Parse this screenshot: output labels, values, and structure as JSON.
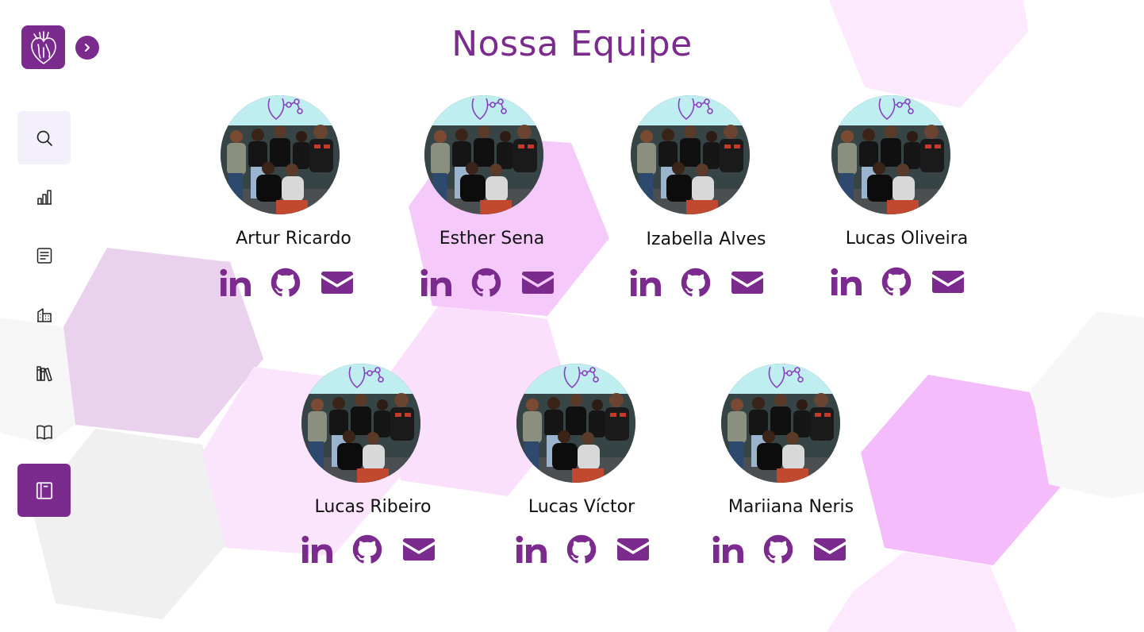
{
  "colors": {
    "accent": "#7b2a8e",
    "hex_pink": "#f2c0fa",
    "hex_grey": "#ececec"
  },
  "sidebar": {
    "logo_icon": "heart-anatomy-icon",
    "expand_icon": "chevron-right-icon",
    "items": [
      {
        "icon": "search-icon",
        "state": "hover"
      },
      {
        "icon": "bar-chart-icon",
        "state": "normal"
      },
      {
        "icon": "document-icon",
        "state": "normal"
      },
      {
        "icon": "buildings-icon",
        "state": "normal"
      },
      {
        "icon": "library-icon",
        "state": "normal"
      },
      {
        "icon": "open-book-icon",
        "state": "normal"
      },
      {
        "icon": "notebook-icon",
        "state": "active"
      }
    ]
  },
  "page": {
    "title": "Nossa Equipe"
  },
  "team": [
    {
      "name": "Artur Ricardo",
      "links": [
        "linkedin-icon",
        "github-icon",
        "email-icon"
      ]
    },
    {
      "name": "Esther Sena",
      "links": [
        "linkedin-icon",
        "github-icon",
        "email-icon"
      ]
    },
    {
      "name": "Izabella Alves",
      "links": [
        "linkedin-icon",
        "github-icon",
        "email-icon"
      ]
    },
    {
      "name": "Lucas Oliveira",
      "links": [
        "linkedin-icon",
        "github-icon",
        "email-icon"
      ]
    },
    {
      "name": "Lucas Ribeiro",
      "links": [
        "linkedin-icon",
        "github-icon",
        "email-icon"
      ]
    },
    {
      "name": "Lucas Víctor",
      "links": [
        "linkedin-icon",
        "github-icon",
        "email-icon"
      ]
    },
    {
      "name": "Mariiana Neris",
      "links": [
        "linkedin-icon",
        "github-icon",
        "email-icon"
      ]
    }
  ]
}
